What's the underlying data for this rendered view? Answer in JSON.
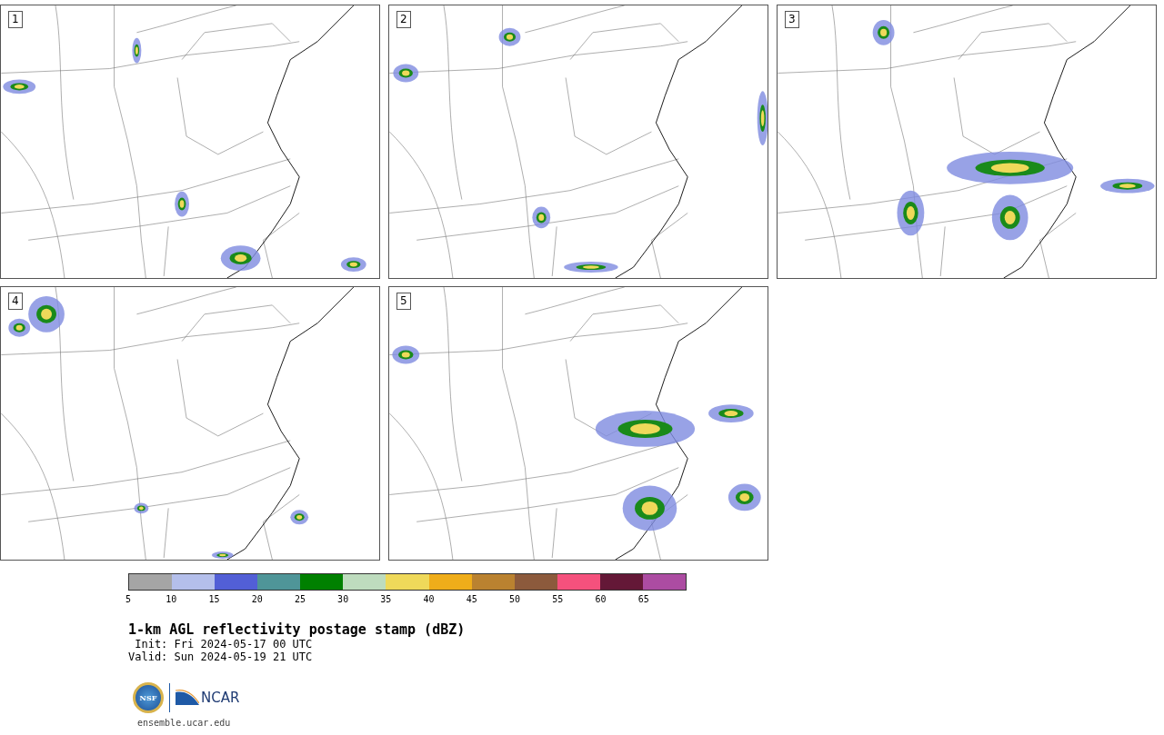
{
  "panels": [
    {
      "label": "1"
    },
    {
      "label": "2"
    },
    {
      "label": "3"
    },
    {
      "label": "4"
    },
    {
      "label": "5"
    }
  ],
  "colorbar": {
    "bins": [
      {
        "color": "#a5a5a5"
      },
      {
        "color": "#b4bfeb"
      },
      {
        "color": "#525fd6"
      },
      {
        "color": "#4f9598"
      },
      {
        "color": "#008000"
      },
      {
        "color": "#bedcbe"
      },
      {
        "color": "#efd95a"
      },
      {
        "color": "#efad1a"
      },
      {
        "color": "#ba8230"
      },
      {
        "color": "#8c5a3c"
      },
      {
        "color": "#f5517d"
      },
      {
        "color": "#641837"
      },
      {
        "color": "#ac4ca2"
      }
    ],
    "ticks": [
      "5",
      "10",
      "15",
      "20",
      "25",
      "30",
      "35",
      "40",
      "45",
      "50",
      "55",
      "60",
      "65"
    ]
  },
  "title": "1-km AGL reflectivity postage stamp (dBZ)",
  "init": " Init: Fri 2024-05-17 00 UTC",
  "valid": "Valid: Sun 2024-05-19 21 UTC",
  "logo": {
    "nsf": "NSF",
    "ncar": "NCAR"
  },
  "website": "ensemble.ucar.edu"
}
